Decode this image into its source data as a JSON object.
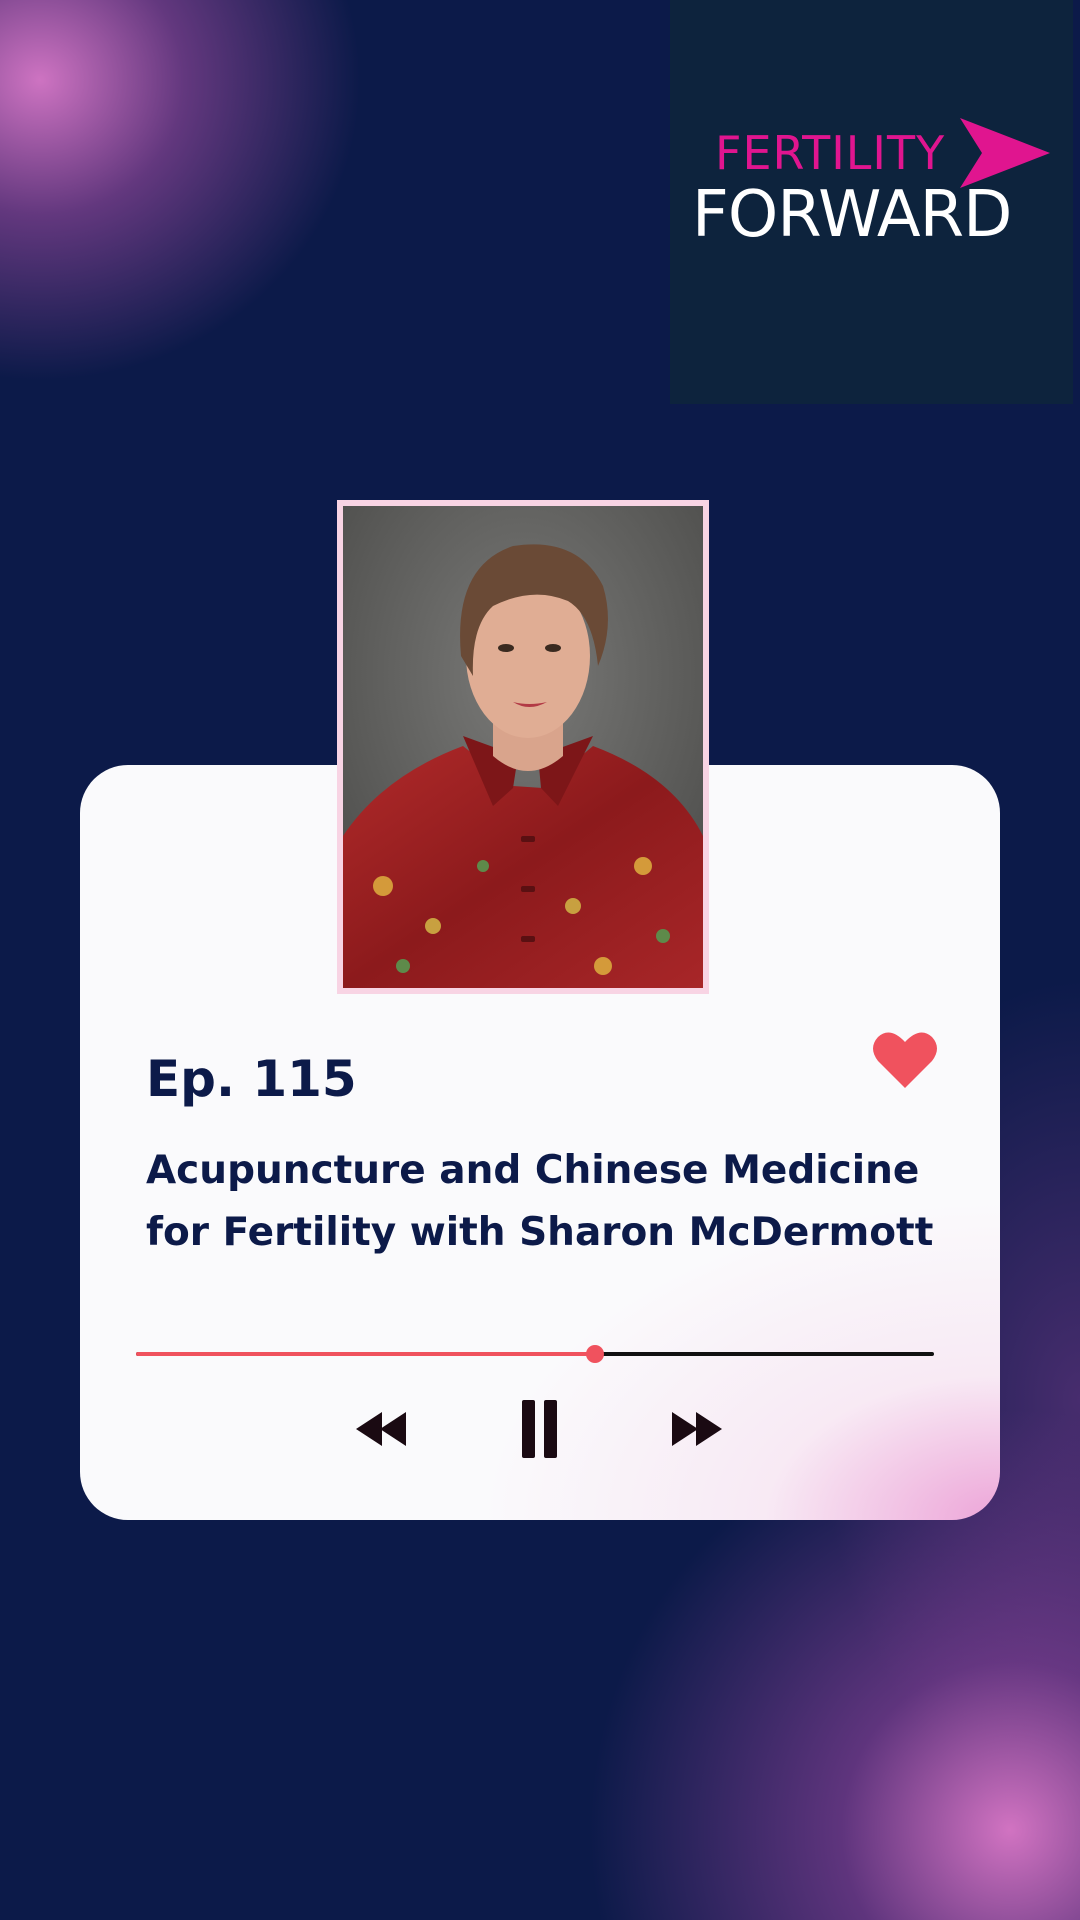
{
  "brand": {
    "line1": "FERTILITY",
    "line2": "FORWARD",
    "accent_color": "#e0158f"
  },
  "episode": {
    "number": "Ep. 115",
    "title": "Acupuncture and Chinese Medicine for Fertility with Sharon McDermott"
  },
  "player": {
    "progress": 0.575,
    "liked": true,
    "state": "playing",
    "icons": {
      "like": "heart-icon",
      "rewind": "rewind-icon",
      "pause": "pause-icon",
      "forward": "fast-forward-icon"
    }
  },
  "colors": {
    "background": "#0c1a49",
    "accent": "#f0525e",
    "text": "#0c1a49",
    "glow": "#d878c8"
  }
}
